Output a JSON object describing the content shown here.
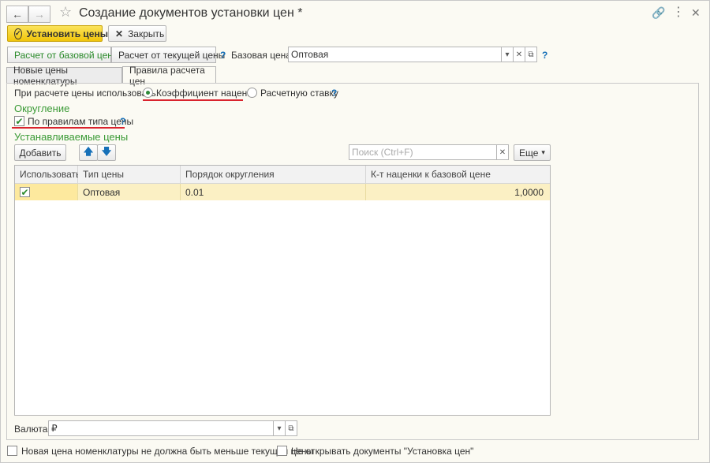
{
  "window": {
    "title": "Создание документов установки цен *"
  },
  "toolbar": {
    "set_prices_label": "Установить цены",
    "close_label": "Закрыть"
  },
  "calc": {
    "from_base_label": "Расчет от базовой цены",
    "from_current_label": "Расчет от текущей цены",
    "help": "?",
    "base_price_label": "Базовая цена:",
    "base_price_value": "Оптовая"
  },
  "tabs": [
    {
      "label": "Новые цены номенклатуры"
    },
    {
      "label": "Правила расчета цен"
    }
  ],
  "rules": {
    "use_label": "При расчете цены использовать:",
    "option_markup": "Коэффициент наценки",
    "option_rate": "Расчетную ставку",
    "help": "?"
  },
  "rounding": {
    "heading": "Округление",
    "by_rules_label": "По правилам типа цены",
    "by_rules_checked": true,
    "help": "?"
  },
  "prices": {
    "heading": "Устанавливаемые цены",
    "add_label": "Добавить",
    "search_placeholder": "Поиск (Ctrl+F)",
    "more_label": "Еще"
  },
  "table": {
    "columns": [
      "Использовать",
      "Тип цены",
      "Порядок округления",
      "К-т наценки к базовой цене"
    ],
    "rows": [
      {
        "use": true,
        "price_type": "Оптовая",
        "rounding": "0.01",
        "markup": "1,0000"
      }
    ]
  },
  "currency": {
    "label": "Валюта:",
    "value": "₽"
  },
  "footer": {
    "option1": "Новая цена номенклатуры не должна быть меньше текущей цены",
    "option2": "Не открывать документы \"Установка цен\""
  },
  "colors": {
    "accent_green": "#3a9a35",
    "primary_yellow": "#f1c50a",
    "underline_red": "#d9232d",
    "selected_row": "#fde99e"
  }
}
